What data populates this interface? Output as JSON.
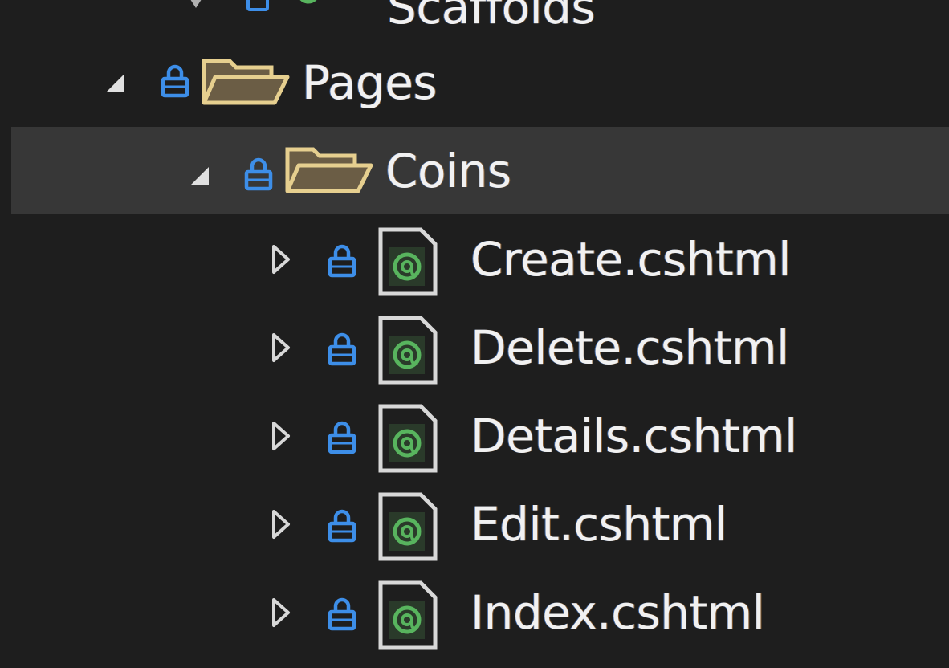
{
  "tree": {
    "partial_item": {
      "label": "Scaffolds"
    },
    "items": [
      {
        "label": "Pages",
        "type": "folder",
        "expanded": true,
        "depth": 0
      },
      {
        "label": "Coins",
        "type": "folder",
        "expanded": true,
        "depth": 1,
        "selected": true
      },
      {
        "label": "Create.cshtml",
        "type": "razor-file",
        "expanded": false,
        "depth": 2
      },
      {
        "label": "Delete.cshtml",
        "type": "razor-file",
        "expanded": false,
        "depth": 2
      },
      {
        "label": "Details.cshtml",
        "type": "razor-file",
        "expanded": false,
        "depth": 2
      },
      {
        "label": "Edit.cshtml",
        "type": "razor-file",
        "expanded": false,
        "depth": 2
      },
      {
        "label": "Index.cshtml",
        "type": "razor-file",
        "expanded": false,
        "depth": 2
      }
    ]
  },
  "icons": {
    "lock": "lock-icon",
    "folder": "folder-open-icon",
    "file": "razor-file-icon",
    "expanded_arrow": "expanded-arrow-icon",
    "collapsed_arrow": "collapsed-arrow-icon"
  },
  "colors": {
    "background": "#1e1e1e",
    "selected_row": "#373737",
    "text": "#f1f1f1",
    "lock": "#3d8ee8",
    "folder_outline": "#e6cf8f",
    "folder_fill": "#6b5d45",
    "razor_at": "#58b45e"
  }
}
